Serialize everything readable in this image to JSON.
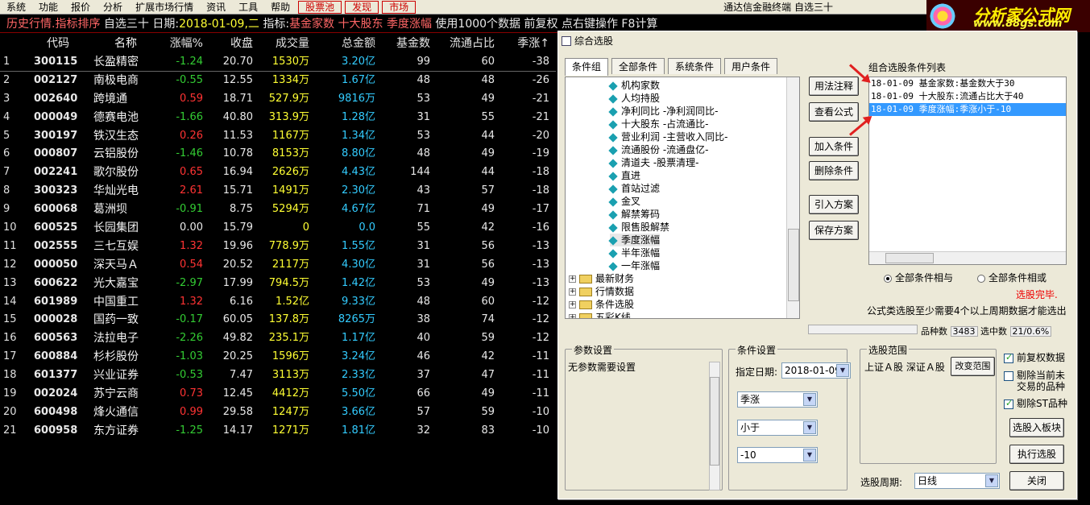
{
  "menu": {
    "items": [
      "系统",
      "功能",
      "报价",
      "分析",
      "扩展市场行情",
      "资讯",
      "工具",
      "帮助"
    ],
    "red_items": [
      "股票池",
      "发现",
      "市场"
    ],
    "window_title": "通达信金融终端 自选三十"
  },
  "logo": {
    "line1": "分析家公式网",
    "line2": "www.88gs.com"
  },
  "infobar": {
    "history": "历史行情.指标排序",
    "selection": "自选三十",
    "date_label": "日期:",
    "date_value": "2018-01-09,二",
    "indicator_label": "指标:",
    "indicators": "基金家数 十大股东 季度涨幅",
    "note": "使用1000个数据 前复权 点右键操作 F8计算"
  },
  "table": {
    "headers": {
      "idx": "",
      "code": "代码",
      "name": "名称",
      "chg": "涨幅%",
      "close": "收盘",
      "vol": "成交量",
      "amt": "总金额",
      "fund": "基金数",
      "flow": "流通占比",
      "season": "季涨↑"
    },
    "rows": [
      {
        "idx": "1",
        "code": "300115",
        "name": "长盈精密",
        "chg": "-1.24",
        "dir": "dn",
        "close": "20.70",
        "vol": "1530万",
        "amt": "3.20亿",
        "fund": "99",
        "flow": "60",
        "season": "-38"
      },
      {
        "idx": "2",
        "code": "002127",
        "name": "南极电商",
        "chg": "-0.55",
        "dir": "dn",
        "close": "12.55",
        "vol": "1334万",
        "amt": "1.67亿",
        "fund": "48",
        "flow": "48",
        "season": "-26"
      },
      {
        "idx": "3",
        "code": "002640",
        "name": "跨境通",
        "chg": "0.59",
        "dir": "up",
        "close": "18.71",
        "vol": "527.9万",
        "amt": "9816万",
        "fund": "53",
        "flow": "49",
        "season": "-21"
      },
      {
        "idx": "4",
        "code": "000049",
        "name": "德赛电池",
        "chg": "-1.66",
        "dir": "dn",
        "close": "40.80",
        "vol": "313.9万",
        "amt": "1.28亿",
        "fund": "31",
        "flow": "55",
        "season": "-21"
      },
      {
        "idx": "5",
        "code": "300197",
        "name": "铁汉生态",
        "chg": "0.26",
        "dir": "up",
        "close": "11.53",
        "vol": "1167万",
        "amt": "1.34亿",
        "fund": "53",
        "flow": "44",
        "season": "-20"
      },
      {
        "idx": "6",
        "code": "000807",
        "name": "云铝股份",
        "chg": "-1.46",
        "dir": "dn",
        "close": "10.78",
        "vol": "8153万",
        "amt": "8.80亿",
        "fund": "48",
        "flow": "49",
        "season": "-19"
      },
      {
        "idx": "7",
        "code": "002241",
        "name": "歌尔股份",
        "chg": "0.65",
        "dir": "up",
        "close": "16.94",
        "vol": "2626万",
        "amt": "4.43亿",
        "fund": "144",
        "flow": "44",
        "season": "-18"
      },
      {
        "idx": "8",
        "code": "300323",
        "name": "华灿光电",
        "chg": "2.61",
        "dir": "up",
        "close": "15.71",
        "vol": "1491万",
        "amt": "2.30亿",
        "fund": "43",
        "flow": "57",
        "season": "-18"
      },
      {
        "idx": "9",
        "code": "600068",
        "name": "葛洲坝",
        "chg": "-0.91",
        "dir": "dn",
        "close": "8.75",
        "vol": "5294万",
        "amt": "4.67亿",
        "fund": "71",
        "flow": "49",
        "season": "-17"
      },
      {
        "idx": "10",
        "code": "600525",
        "name": "长园集团",
        "chg": "0.00",
        "dir": "flat",
        "close": "15.79",
        "vol": "0",
        "amt": "0.0",
        "fund": "55",
        "flow": "42",
        "season": "-16"
      },
      {
        "idx": "11",
        "code": "002555",
        "name": "三七互娱",
        "chg": "1.32",
        "dir": "up",
        "close": "19.96",
        "vol": "778.9万",
        "amt": "1.55亿",
        "fund": "31",
        "flow": "56",
        "season": "-13"
      },
      {
        "idx": "12",
        "code": "000050",
        "name": "深天马Ａ",
        "chg": "0.54",
        "dir": "up",
        "close": "20.52",
        "vol": "2117万",
        "amt": "4.30亿",
        "fund": "31",
        "flow": "56",
        "season": "-13"
      },
      {
        "idx": "13",
        "code": "600622",
        "name": "光大嘉宝",
        "chg": "-2.97",
        "dir": "dn",
        "close": "17.99",
        "vol": "794.5万",
        "amt": "1.42亿",
        "fund": "53",
        "flow": "49",
        "season": "-13"
      },
      {
        "idx": "14",
        "code": "601989",
        "name": "中国重工",
        "chg": "1.32",
        "dir": "up",
        "close": "6.16",
        "vol": "1.52亿",
        "amt": "9.33亿",
        "fund": "48",
        "flow": "60",
        "season": "-12"
      },
      {
        "idx": "15",
        "code": "000028",
        "name": "国药一致",
        "chg": "-0.17",
        "dir": "dn",
        "close": "60.05",
        "vol": "137.8万",
        "amt": "8265万",
        "fund": "38",
        "flow": "74",
        "season": "-12"
      },
      {
        "idx": "16",
        "code": "600563",
        "name": "法拉电子",
        "chg": "-2.26",
        "dir": "dn",
        "close": "49.82",
        "vol": "235.1万",
        "amt": "1.17亿",
        "fund": "40",
        "flow": "59",
        "season": "-12"
      },
      {
        "idx": "17",
        "code": "600884",
        "name": "杉杉股份",
        "chg": "-1.03",
        "dir": "dn",
        "close": "20.25",
        "vol": "1596万",
        "amt": "3.24亿",
        "fund": "46",
        "flow": "42",
        "season": "-11"
      },
      {
        "idx": "18",
        "code": "601377",
        "name": "兴业证券",
        "chg": "-0.53",
        "dir": "dn",
        "close": "7.47",
        "vol": "3113万",
        "amt": "2.33亿",
        "fund": "37",
        "flow": "47",
        "season": "-11"
      },
      {
        "idx": "19",
        "code": "002024",
        "name": "苏宁云商",
        "chg": "0.73",
        "dir": "up",
        "close": "12.45",
        "vol": "4412万",
        "amt": "5.50亿",
        "fund": "66",
        "flow": "49",
        "season": "-11"
      },
      {
        "idx": "20",
        "code": "600498",
        "name": "烽火通信",
        "chg": "0.99",
        "dir": "up",
        "close": "29.58",
        "vol": "1247万",
        "amt": "3.66亿",
        "fund": "57",
        "flow": "59",
        "season": "-10"
      },
      {
        "idx": "21",
        "code": "600958",
        "name": "东方证券",
        "chg": "-1.25",
        "dir": "dn",
        "close": "14.17",
        "vol": "1271万",
        "amt": "1.81亿",
        "fund": "32",
        "flow": "83",
        "season": "-10"
      }
    ]
  },
  "dialog": {
    "title": "综合选股",
    "tabs": [
      "条件组",
      "全部条件",
      "系统条件",
      "用户条件"
    ],
    "tree_items": [
      "机构家数",
      "人均持股",
      "净利同比 -净利润同比-",
      "十大股东 -占流通比-",
      "营业利润 -主营收入同比-",
      "流通股份 -流通盘亿-",
      "清道夫 -股票清理-",
      "直进",
      "首站过滤",
      "金叉",
      "解禁筹码",
      "限售股解禁",
      "季度涨幅",
      "半年涨幅",
      "一年涨幅"
    ],
    "tree_folders": [
      "最新财务",
      "行情数据",
      "条件选股",
      "五彩K线"
    ],
    "buttons": {
      "usage": "用法注释",
      "view_formula": "查看公式",
      "add": "加入条件",
      "delete": "删除条件",
      "import": "引入方案",
      "save": "保存方案",
      "change_range": "改变范围",
      "to_block": "选股入板块",
      "execute": "执行选股",
      "close": "关闭"
    },
    "cond_list_label": "组合选股条件列表",
    "cond_list": [
      "18-01-09 基金家数:基金数大于30",
      "18-01-09 十大股东:流通占比大于40",
      "18-01-09 季度涨幅:季涨小于-10"
    ],
    "radio_and": "全部条件相与",
    "radio_or": "全部条件相或",
    "finish": "选股完毕.",
    "formula_note": "公式类选股至少需要4个以上周期数据才能选出",
    "count_label": "品种数",
    "count_value": "3483",
    "selected_label": "选中数",
    "selected_value": "21/0.6%",
    "param_group": "参数设置",
    "param_text": "无参数需要设置",
    "cond_group": "条件设置",
    "date_label": "指定日期:",
    "date_value": "2018-01-09",
    "field1": "季涨",
    "field2": "小于",
    "field3": "-10",
    "range_group": "选股范围",
    "range_text": "上证Ａ股 深证Ａ股",
    "chk_adjust": "前复权数据",
    "chk_exclude_new_1": "剔除当前未",
    "chk_exclude_new_2": "交易的品种",
    "chk_exclude_st": "剔除ST品种",
    "period_label": "选股周期:",
    "period_value": "日线"
  },
  "colors": {
    "up": "#ff3333",
    "down": "#33cc33",
    "volume": "#ffff33",
    "amount": "#33ccff",
    "selection": "#3399ff",
    "annotation_arrow": "#e02020"
  }
}
